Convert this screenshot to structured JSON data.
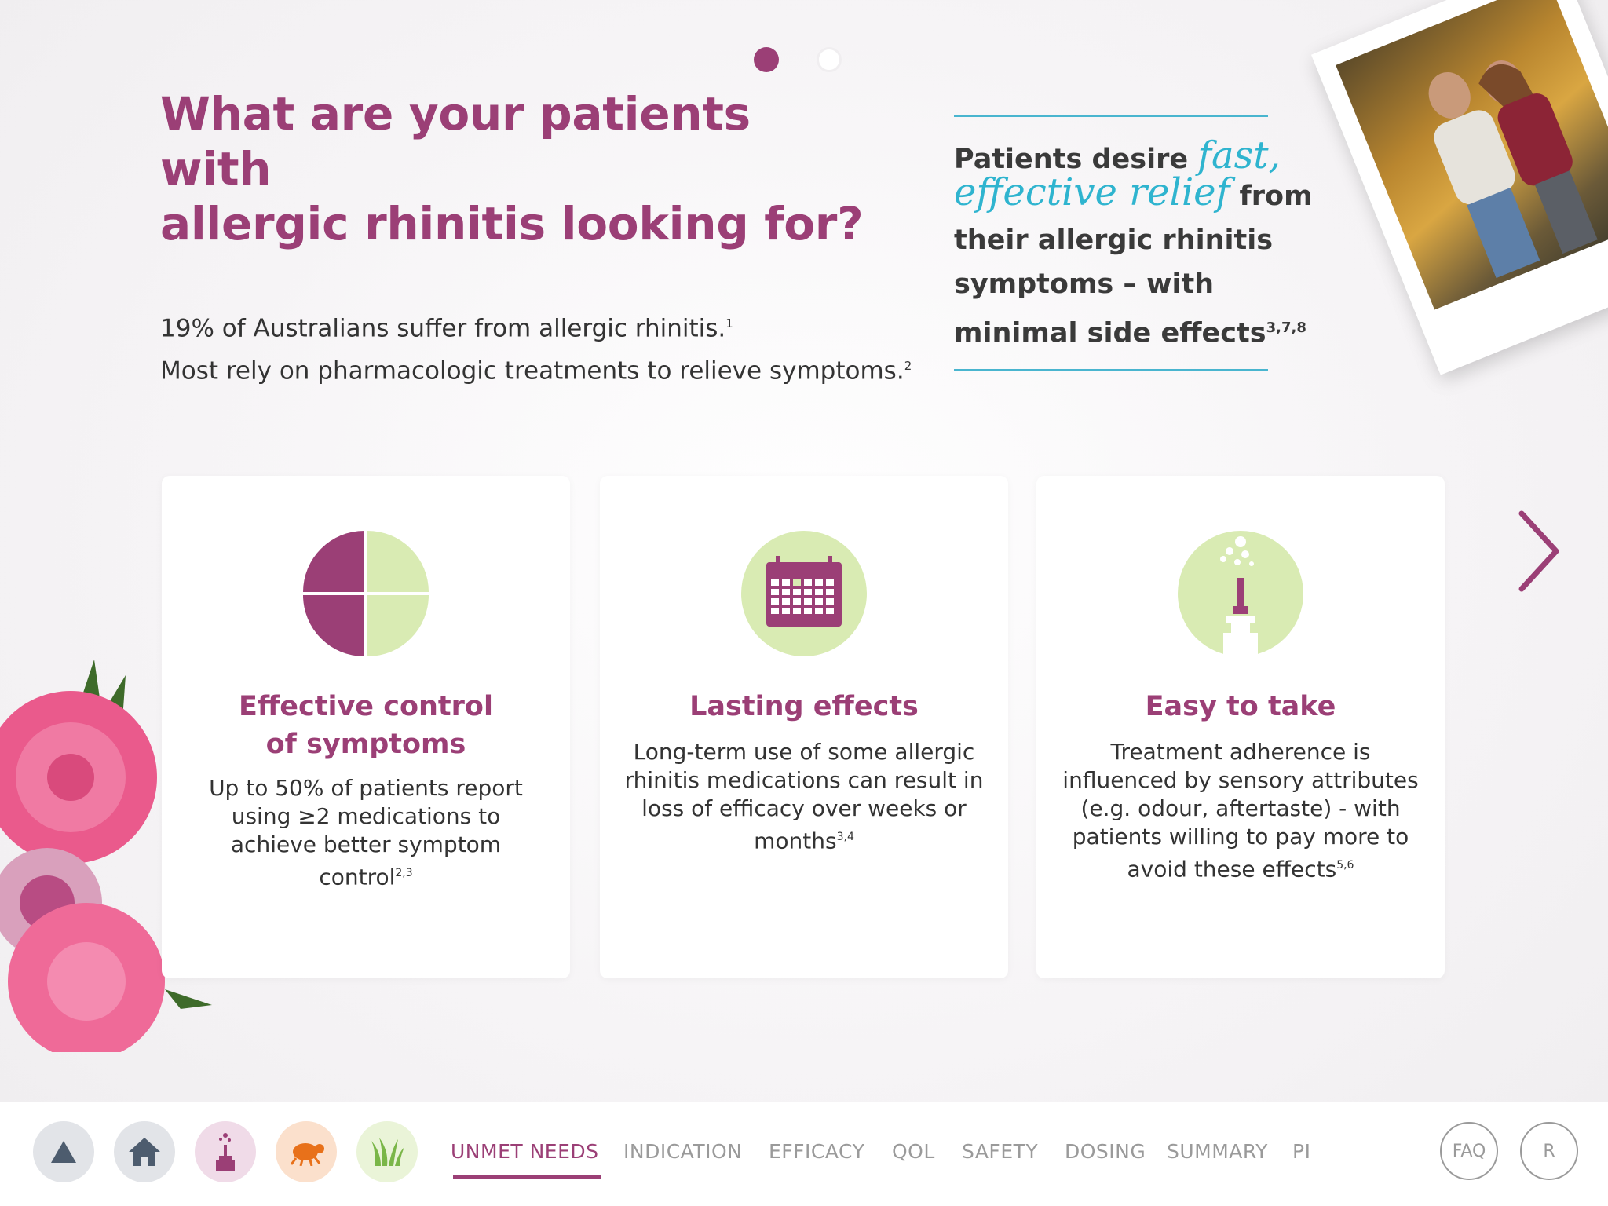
{
  "pager": {
    "pages": 2,
    "current": 1
  },
  "headline": {
    "line1": "What are your patients with",
    "line2": "allergic rhinitis looking for?"
  },
  "intro": {
    "line1": "19% of Australians suffer from allergic rhinitis.",
    "line1_ref": "1",
    "line2": "Most rely on pharmacologic treatments to relieve symptoms.",
    "line2_ref": "2"
  },
  "quote": {
    "pre": "Patients desire ",
    "script1": "fast,",
    "script2": "effective relief",
    "post1": " from",
    "post2": "their allergic rhinitis",
    "post3": "symptoms – with",
    "post4": "minimal side effects",
    "ref": "3,7,8"
  },
  "cards": [
    {
      "title1": "Effective control",
      "title2": "of symptoms",
      "body": "Up to 50% of patients report using ≥2 medications to achieve better symptom control",
      "ref": "2,3",
      "icon": "pie-quadrants-icon"
    },
    {
      "title1": "Lasting effects",
      "title2": "",
      "body": "Long-term use of some allergic rhinitis medications can result in loss of efficacy over weeks or months",
      "ref": "3,4",
      "icon": "calendar-icon"
    },
    {
      "title1": "Easy to take",
      "title2": "",
      "body": "Treatment adherence is influenced by sensory attributes (e.g. odour, aftertaste) - with patients willing to pay more to avoid these effects",
      "ref": "5,6",
      "icon": "nasal-spray-icon"
    }
  ],
  "nav": {
    "icons": [
      "up-arrow-icon",
      "home-icon",
      "nasal-spray-icon",
      "dust-mite-icon",
      "grass-icon"
    ],
    "tabs": [
      "UNMET NEEDS",
      "INDICATION",
      "EFFICACY",
      "QOL",
      "SAFETY",
      "DOSING",
      "SUMMARY",
      "PI"
    ],
    "active_tab": "UNMET NEEDS",
    "faq": "FAQ",
    "r": "R"
  },
  "colors": {
    "brand": "#9b3f76",
    "accent": "#2fb4cf",
    "lime": "#d9ebb3"
  }
}
